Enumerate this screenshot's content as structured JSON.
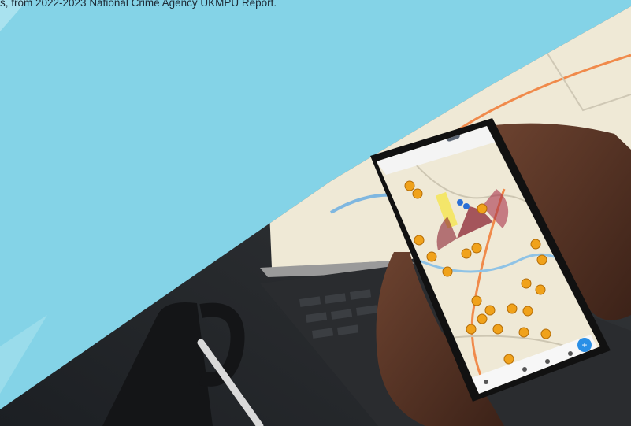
{
  "caption": {
    "text": "s, from 2022-2023 National Crime Agency UKMPU Report."
  },
  "colors": {
    "background": "#84d3e7",
    "map_land": "#efe9d6",
    "marker": "#f0a21b",
    "marker_outline": "#b46c06",
    "heat_sector": "#8b2332",
    "fab": "#2a8fe6"
  },
  "map_app": {
    "fab_label": "+"
  }
}
